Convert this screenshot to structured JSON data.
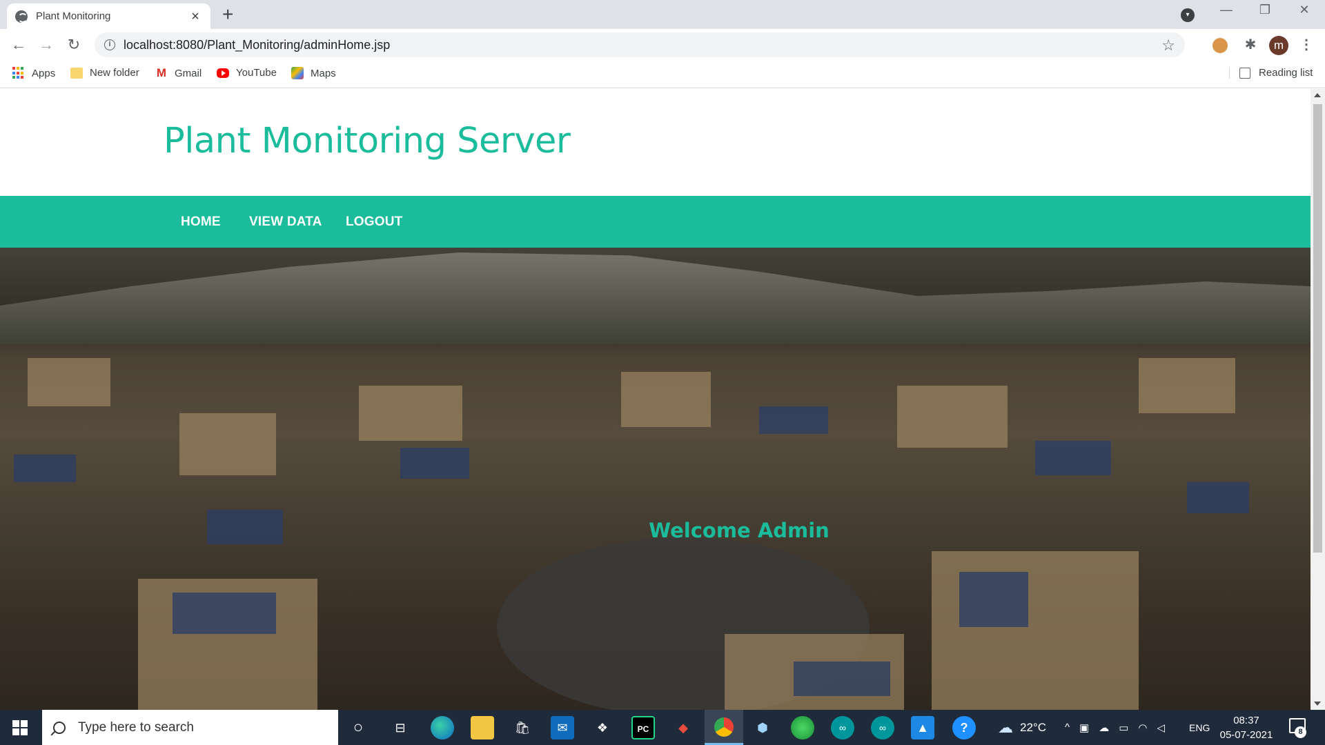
{
  "browser": {
    "tab": {
      "title": "Plant Monitoring",
      "close": "×"
    },
    "new_tab": "+",
    "window_controls": {
      "minimize": "—",
      "maximize": "❐",
      "close": "✕"
    },
    "nav": {
      "back": "←",
      "forward": "→",
      "reload": "↻"
    },
    "address": {
      "url": "localhost:8080/Plant_Monitoring/adminHome.jsp",
      "bookmark_icon": "star-icon"
    },
    "profile_initial": "m",
    "bookmarks": [
      {
        "label": "Apps",
        "icon": "apps-grid-icon"
      },
      {
        "label": "New folder",
        "icon": "folder-icon"
      },
      {
        "label": "Gmail",
        "icon": "gmail-icon"
      },
      {
        "label": "YouTube",
        "icon": "youtube-icon"
      },
      {
        "label": "Maps",
        "icon": "maps-icon"
      }
    ],
    "reading_list": "Reading list"
  },
  "site": {
    "title": "Plant Monitoring Server",
    "nav": [
      {
        "label": "HOME"
      },
      {
        "label": "VIEW DATA"
      },
      {
        "label": "LOGOUT"
      }
    ],
    "welcome": "Welcome Admin",
    "accent_color": "#1abc9c"
  },
  "taskbar": {
    "search_placeholder": "Type here to search",
    "weather": "22°C",
    "language": "ENG",
    "time": "08:37",
    "date": "05-07-2021",
    "notifications": "8"
  }
}
